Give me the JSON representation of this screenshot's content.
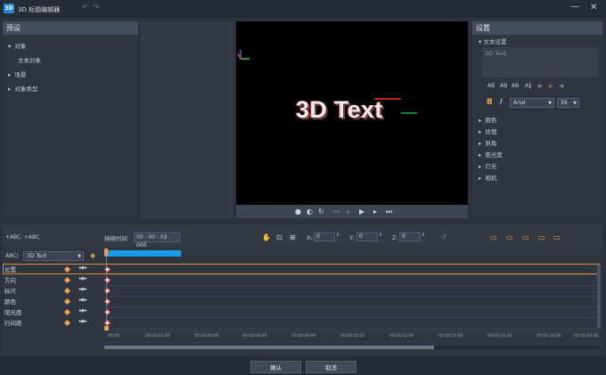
{
  "window": {
    "icon": "3D",
    "title": "3D 标题编辑器",
    "min": "—",
    "close": "✕"
  },
  "presets": {
    "header": "预设",
    "items": [
      {
        "label": "对象",
        "expanded": true
      },
      {
        "label": "文本对象",
        "expanded": null
      },
      {
        "label": "场景",
        "expanded": false
      },
      {
        "label": "对象类型",
        "expanded": false
      }
    ]
  },
  "preview": {
    "text": "3D Text"
  },
  "settings": {
    "header": "设置",
    "text_settings": "文本设置",
    "text_box": "3D Text",
    "font": "Arial",
    "size": "36",
    "sections": [
      "颜色",
      "纹理",
      "斜角",
      "阻光度",
      "灯光",
      "相机"
    ]
  },
  "timeline": {
    "add_text1": "+ABC",
    "add_text2": "+ABC",
    "duration_label": "持续时间",
    "duration_value": "00 : 00 : 03 . 000",
    "x_label": "X:",
    "x_value": "0",
    "y_label": "Y:",
    "y_value": "0",
    "z_label": "Z:",
    "z_value": "0",
    "object_prefix": "ABC|",
    "object_select": "3D Text",
    "tracks": [
      "位置",
      "方向",
      "标尺",
      "颜色",
      "阻光度",
      "行间距"
    ],
    "ruler": [
      "00:00",
      "00:00:02:00",
      "00:00:04:00",
      "00:00:06:00",
      "00:00:08:00",
      "00:00:10:00",
      "00:00:12:00",
      "00:00:14:00",
      "00:00:16:00",
      "00:00:18:00",
      "00:00:20:00"
    ]
  },
  "buttons": {
    "ok": "确认",
    "cancel": "取消"
  },
  "colors": {
    "accent_blue": "#1e9be8",
    "keyframe_orange": "#f0a24a",
    "selection_orange": "#e08a2a"
  }
}
